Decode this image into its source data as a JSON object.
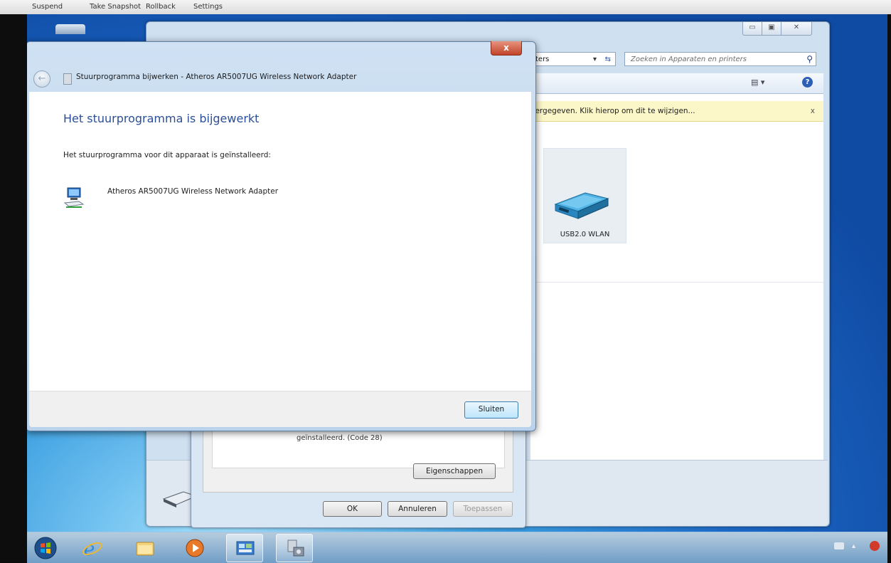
{
  "vm_menu": {
    "items": [
      "Suspend",
      "Take Snapshot",
      "Rollback",
      "Settings"
    ]
  },
  "explorer": {
    "address_fragment": "ters",
    "search_placeholder": "Zoeken in Apparaten en printers",
    "info_bar_text": "eergegeven. Klik hierop om dit te wijzigen...",
    "info_bar_close": "x",
    "device_label": "USB2.0 WLAN"
  },
  "properties_dialog": {
    "status_text": "geïnstalleerd. (Code 28)",
    "properties_button": "Eigenschappen",
    "ok_button": "OK",
    "cancel_button": "Annuleren",
    "apply_button": "Toepassen"
  },
  "wizard": {
    "title": "Stuurprogramma bijwerken - Atheros AR5007UG Wireless Network Adapter",
    "heading": "Het stuurprogramma is bijgewerkt",
    "subtext": "Het stuurprogramma voor dit apparaat is geïnstalleerd:",
    "device_name": "Atheros AR5007UG Wireless Network Adapter",
    "close_button": "Sluiten",
    "close_glyph": "x"
  },
  "colors": {
    "heading_blue": "#2b4f95",
    "info_bar_bg": "#fcf7c8",
    "close_red": "#c2432a"
  },
  "taskbar": {
    "icons": [
      "start-orb-icon",
      "internet-explorer-icon",
      "file-explorer-icon",
      "media-player-icon",
      "control-panel-icon",
      "device-manager-icon"
    ]
  }
}
